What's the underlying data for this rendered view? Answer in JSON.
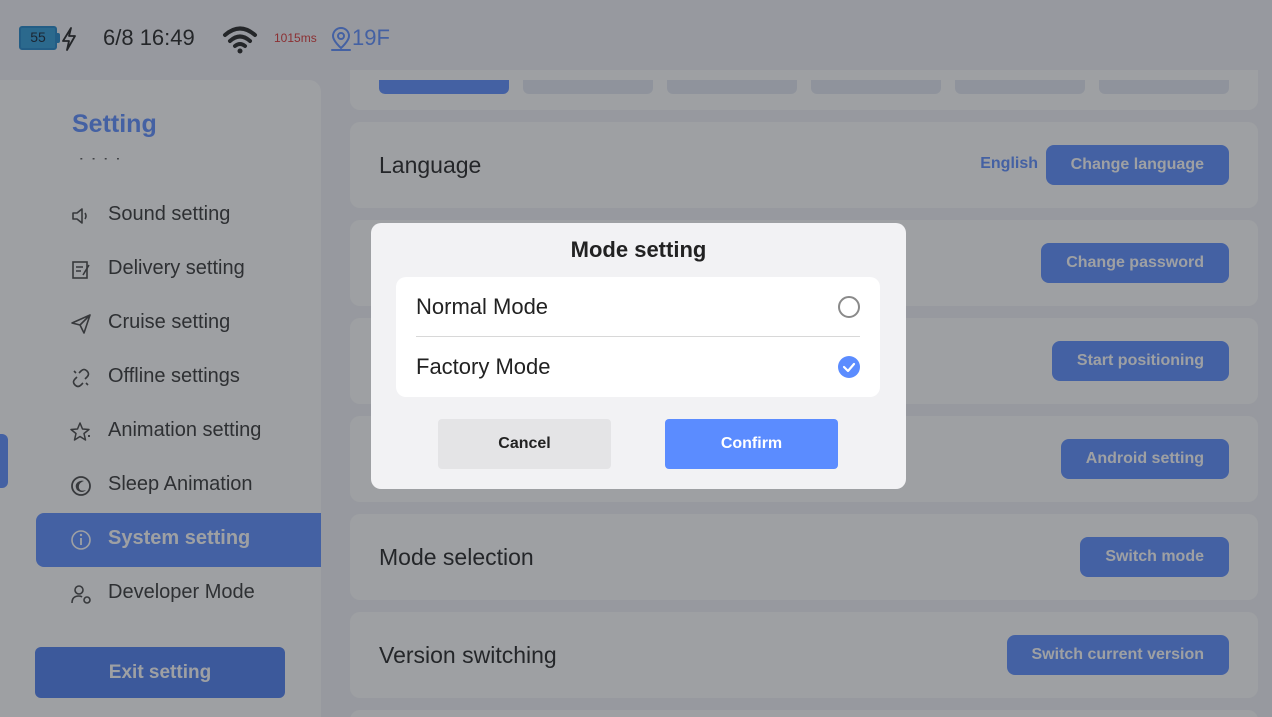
{
  "status_bar": {
    "battery_level": "55",
    "datetime": "6/8 16:49",
    "latency": "1015ms",
    "floor": "19F",
    "icons": [
      "battery-icon",
      "charging-bolt-icon",
      "wifi-icon",
      "location-pin-icon"
    ]
  },
  "sidebar": {
    "title": "Setting",
    "partial_item": "· · ·   ·",
    "items": [
      {
        "label": "Sound setting",
        "icon": "speaker-icon"
      },
      {
        "label": "Delivery setting",
        "icon": "edit-note-icon"
      },
      {
        "label": "Cruise setting",
        "icon": "paper-plane-icon"
      },
      {
        "label": "Offline settings",
        "icon": "broken-link-icon"
      },
      {
        "label": "Animation setting",
        "icon": "sparkle-star-icon"
      },
      {
        "label": "Sleep Animation",
        "icon": "moon-icon"
      },
      {
        "label": "System setting",
        "icon": "info-icon",
        "active": true
      },
      {
        "label": "Developer Mode",
        "icon": "user-gear-icon"
      }
    ],
    "exit_label": "Exit setting"
  },
  "content": {
    "cards": [
      {
        "label": "Language",
        "value": "English",
        "button": "Change language"
      },
      {
        "label": "",
        "button": "Change password"
      },
      {
        "label": "",
        "button": "Start positioning"
      },
      {
        "label": "",
        "button": "Android setting"
      },
      {
        "label": "Mode selection",
        "button": "Switch mode"
      },
      {
        "label": "Version switching",
        "button": "Switch current version"
      }
    ]
  },
  "modal": {
    "title": "Mode setting",
    "options": [
      {
        "label": "Normal Mode",
        "selected": false
      },
      {
        "label": "Factory Mode",
        "selected": true
      }
    ],
    "cancel_label": "Cancel",
    "confirm_label": "Confirm"
  },
  "colors": {
    "accent": "#5b8cff",
    "overlay": "rgba(40,44,52,0.45)",
    "latency_warning": "#dd3333",
    "battery": "#2e9bd8"
  }
}
